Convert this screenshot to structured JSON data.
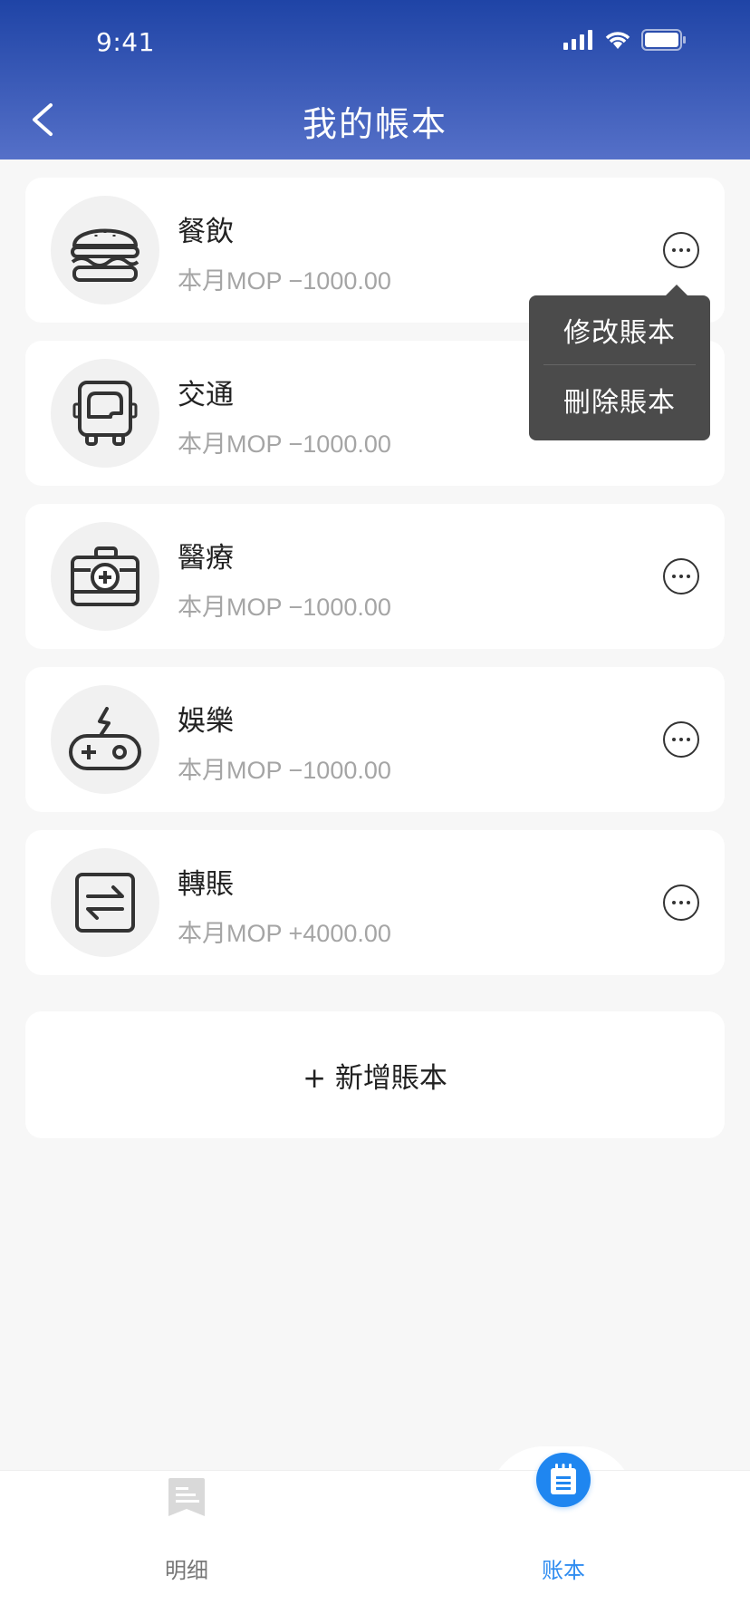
{
  "status": {
    "time": "9:41"
  },
  "header": {
    "title": "我的帳本"
  },
  "books": [
    {
      "name": "餐飲",
      "amount": "本月MOP −1000.00",
      "icon": "burger-icon"
    },
    {
      "name": "交通",
      "amount": "本月MOP −1000.00",
      "icon": "bus-icon"
    },
    {
      "name": "醫療",
      "amount": "本月MOP −1000.00",
      "icon": "medical-kit-icon"
    },
    {
      "name": "娛樂",
      "amount": "本月MOP −1000.00",
      "icon": "gamepad-icon"
    },
    {
      "name": "轉賬",
      "amount": "本月MOP +4000.00",
      "icon": "transfer-icon"
    }
  ],
  "popup": {
    "edit_label": "修改賬本",
    "delete_label": "刪除賬本"
  },
  "add_button": {
    "label": "+ 新增賬本"
  },
  "tabbar": {
    "left_label": "明细",
    "right_label": "账本",
    "active_color": "#2f8cf0"
  },
  "colors": {
    "header_top": "#1f44a6",
    "header_bottom": "#5570c8",
    "accent": "#1f86f0"
  }
}
